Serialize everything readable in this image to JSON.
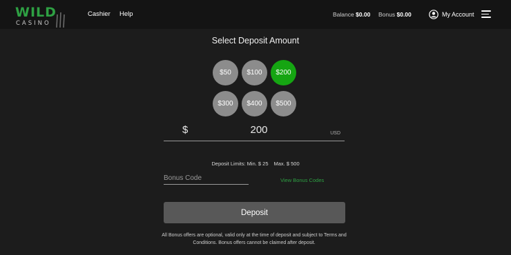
{
  "header": {
    "logo": {
      "top": "WILD",
      "bottom": "CASINO"
    },
    "nav": [
      "Cashier",
      "Help"
    ],
    "balance_label": "Balance",
    "balance_value": "$0.00",
    "bonus_label": "Bonus",
    "bonus_value": "$0.00",
    "account_label": "My Account"
  },
  "deposit": {
    "title": "Select Deposit Amount",
    "amounts": [
      "$50",
      "$100",
      "$200",
      "$300",
      "$400",
      "$500"
    ],
    "selected_amount": "$200",
    "currency_symbol": "$",
    "amount_value": "200",
    "currency_code": "USD",
    "limits_label": "Deposit Limits:",
    "limits_min": "Min. $ 25",
    "limits_max": "Max. $ 500",
    "bonus_code_placeholder": "Bonus Code",
    "view_bonus_codes": "View Bonus Codes",
    "deposit_button": "Deposit",
    "disclaimer": "All Bonus offers are optional, valid only at the time of deposit and subject to Terms and Conditions. Bonus offers cannot be claimed after deposit."
  },
  "colors": {
    "background": "#1c1c1c",
    "header": "#141414",
    "accent_green": "#15a512",
    "logo_green": "#2ea043",
    "chip_gray": "#8c8c8c",
    "button_gray": "#585858"
  }
}
